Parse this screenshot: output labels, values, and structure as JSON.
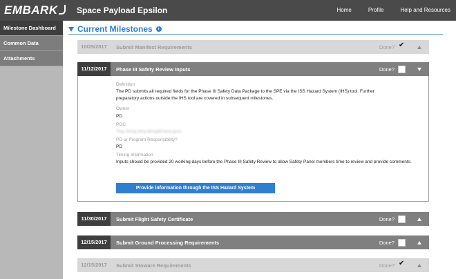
{
  "app": {
    "logo": "EMBARK",
    "title": "Space Payload Epsilon"
  },
  "nav": {
    "home": "Home",
    "profile": "Profile",
    "help": "Help and Resources"
  },
  "sidebar": {
    "items": [
      {
        "label": "Milestone Dashboard"
      },
      {
        "label": "Common Data"
      },
      {
        "label": "Attachments"
      }
    ]
  },
  "section": {
    "title": "Current Milestones",
    "info_icon": "i"
  },
  "milestones": [
    {
      "date": "10/25/2017",
      "name": "Submit Manifest Requirements",
      "done_label": "Done?",
      "done": true,
      "state": "faded",
      "chevron": "up"
    },
    {
      "date": "11/12/2017",
      "name": "Phase III Safety Review Inputs",
      "done_label": "Done?",
      "done": false,
      "state": "expanded",
      "chevron": "down"
    },
    {
      "date": "11/30/2017",
      "name": "Submit Flight Safety Certificate",
      "done_label": "Done?",
      "done": false,
      "state": "dark",
      "chevron": "up"
    },
    {
      "date": "12/15/2017",
      "name": "Submit Ground Processing Requirements",
      "done_label": "Done?",
      "done": false,
      "state": "dark",
      "chevron": "up"
    },
    {
      "date": "12/15/2017",
      "name": "Submit Stoware Requirements",
      "done_label": "Done?",
      "done": true,
      "state": "faded",
      "chevron": "up"
    }
  ],
  "detail": {
    "definition_label": "Definition",
    "definition_line1": "The PD  submits all required fields for the Phase III Safety Data Package to the SPE via the ISS Hazard System (IHS) tool.  Further",
    "definition_line2": "preparatory actions outside the IHS tool are covered in subsequent milestones.",
    "owner_label": "Owner",
    "owner_value": "PD",
    "poc_label": "POC",
    "poc_value": "Tiny Deng (tiny.deng@nasa.gov)",
    "responsibility_label": "PD or Program Responsibility?",
    "responsibility_value": "PD",
    "timing_label": "Timing Information",
    "timing_value": "Inputs should be provided 20 working days before the Phase III Safety Review to allow Safety Panel members time to review and provide comments.",
    "action_button": "Provide information through the ISS Hazard System"
  },
  "icons": {
    "check": "✔"
  },
  "colors": {
    "accent": "#2a7fd0",
    "topbar": "#4a4a4a",
    "dark_date": "#3e3e3e"
  }
}
